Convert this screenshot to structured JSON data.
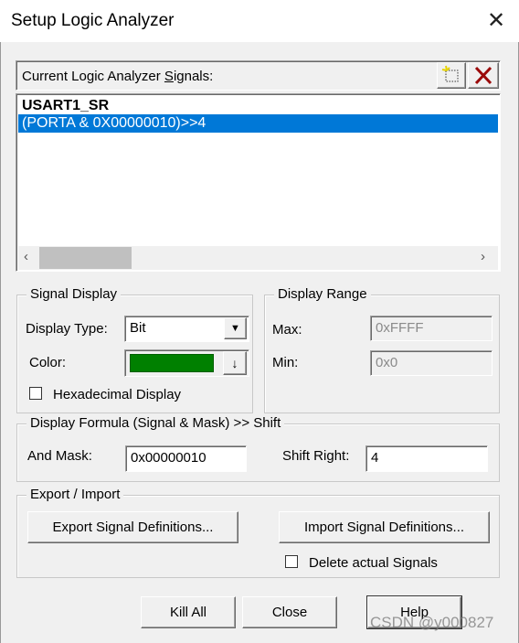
{
  "window": {
    "title": "Setup Logic Analyzer",
    "close_icon": "close-icon"
  },
  "signals": {
    "label": "Current Logic Analyzer Signals:",
    "new_icon": "new-signal-icon",
    "delete_icon": "delete-icon",
    "items": [
      {
        "label": "USART1_SR",
        "selected": false
      },
      {
        "label": "(PORTA & 0X00000010)>>4",
        "selected": true
      }
    ],
    "selection_color": "#0078d7"
  },
  "signal_display": {
    "legend": "Signal Display",
    "display_type_label": "Display Type:",
    "display_type_value": "Bit",
    "color_label": "Color:",
    "color_value": "#008000",
    "hex_label": "Hexadecimal Display",
    "hex_checked": false
  },
  "display_range": {
    "legend": "Display Range",
    "max_label": "Max:",
    "max_value": "0xFFFF",
    "min_label": "Min:",
    "min_value": "0x0"
  },
  "formula": {
    "legend": "Display Formula (Signal & Mask) >> Shift",
    "mask_label": "And Mask:",
    "mask_value": "0x00000010",
    "shift_label": "Shift Right:",
    "shift_value": "4"
  },
  "export_import": {
    "legend": "Export / Import",
    "export_button": "Export Signal Definitions...",
    "import_button": "Import Signal Definitions...",
    "delete_label": "Delete actual Signals",
    "delete_checked": false
  },
  "buttons": {
    "kill_all": "Kill All",
    "close": "Close",
    "help": "Help"
  },
  "watermark": "CSDN @y000827"
}
